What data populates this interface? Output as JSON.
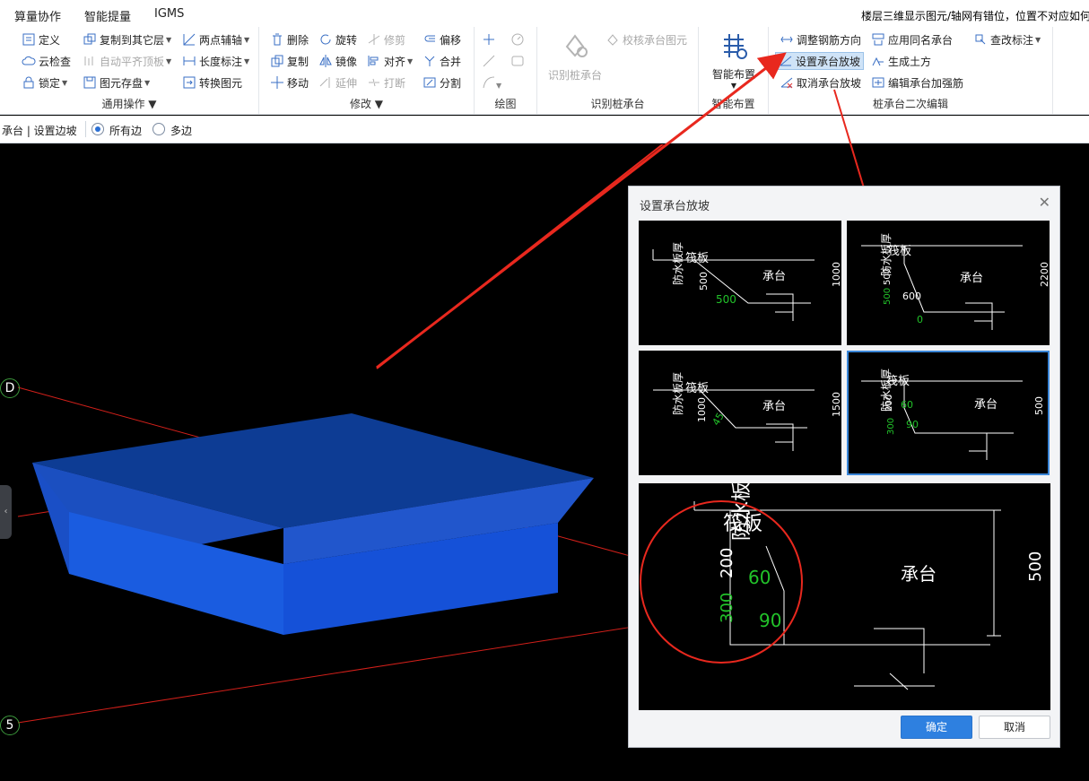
{
  "menu": {
    "tabs": [
      "算量协作",
      "智能提量",
      "IGMS"
    ]
  },
  "notice": "楼层三维显示图元/轴网有错位，位置不对应如何",
  "ribbon": {
    "general": {
      "title": "通用操作",
      "items": [
        "定义",
        "云检查",
        "锁定",
        "复制到其它层",
        "自动平齐顶板",
        "图元存盘",
        "两点辅轴",
        "长度标注",
        "转换图元"
      ]
    },
    "modify": {
      "title": "修改",
      "items": [
        "删除",
        "复制",
        "移动",
        "旋转",
        "镜像",
        "延伸",
        "修剪",
        "对齐",
        "打断",
        "偏移",
        "合并",
        "分割"
      ]
    },
    "draw": {
      "title": "绘图"
    },
    "identify": {
      "title": "识别桩承台",
      "items": [
        "识别桩承台",
        "校核承台图元"
      ]
    },
    "smart": {
      "title": "智能布置",
      "button": "智能布置"
    },
    "edit": {
      "title": "桩承台二次编辑",
      "items": [
        "调整钢筋方向",
        "设置承台放坡",
        "取消承台放坡",
        "应用同名承台",
        "生成土方",
        "编辑承台加强筋",
        "查改标注"
      ]
    }
  },
  "optionbar": {
    "breadcrumb": "承台 | 设置边坡",
    "options": [
      "所有边",
      "多边"
    ],
    "selected": "所有边"
  },
  "canvas": {
    "axes": [
      "D",
      "5"
    ]
  },
  "dialog": {
    "title": "设置承台放坡",
    "ok": "确定",
    "cancel": "取消",
    "thumbs": [
      {
        "labels": {
          "waterproof": "防水板厚",
          "raft": "筏板",
          "cap": "承台"
        },
        "dims": [
          "500",
          "500",
          "1000"
        ]
      },
      {
        "labels": {
          "waterproof": "防水板厚",
          "raft": "筏板",
          "cap": "承台"
        },
        "dims": [
          "500",
          "500",
          "600",
          "0",
          "2200"
        ]
      },
      {
        "labels": {
          "waterproof": "防水板厚",
          "raft": "筏板",
          "cap": "承台"
        },
        "dims": [
          "1000",
          "45",
          "1500"
        ]
      },
      {
        "labels": {
          "waterproof": "防水板厚",
          "raft": "筏板",
          "cap": "承台"
        },
        "dims": [
          "200",
          "300",
          "60",
          "90",
          "500"
        ]
      }
    ],
    "preview": {
      "labels": {
        "waterproof": "防水板厚",
        "raft": "筏板",
        "cap": "承台"
      },
      "dims": {
        "d200": "200",
        "d300": "300",
        "d60": "60",
        "d90": "90",
        "d500": "500"
      }
    }
  },
  "colors": {
    "cap_top": "#0e3f9a",
    "cap_side": "#1a5ce8",
    "cap_slope": "#1f4fc4",
    "annotation": "#e82a1f",
    "green": "#22c32a"
  }
}
